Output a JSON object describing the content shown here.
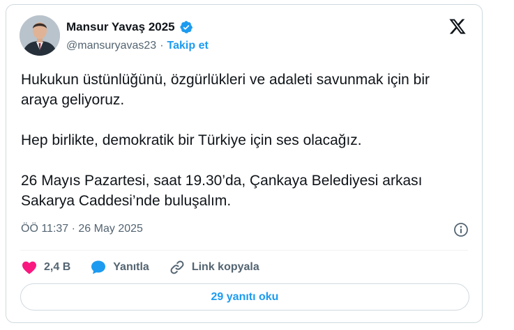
{
  "author": {
    "display_name": "Mansur Yavaş 2025",
    "handle": "@mansuryavas23",
    "separator": "·",
    "follow_label": "Takip et",
    "verified": true
  },
  "tweet": {
    "paragraphs": [
      "Hukukun üstünlüğünü, özgürlükleri ve adaleti savunmak için bir araya geliyoruz.",
      "Hep birlikte, demokratik bir Türkiye için ses olacağız.",
      "26 Mayıs Pazartesi, saat 19.30’da, Çankaya Belediyesi arkası Sakarya Caddesi’nde buluşalım."
    ],
    "timestamp": "ÖÖ 11:37 · 26 May 2025"
  },
  "actions": {
    "like_count": "2,4 B",
    "reply_label": "Yanıtla",
    "copy_link_label": "Link kopyala"
  },
  "read_replies_label": "29 yanıtı oku",
  "icons": {
    "platform": "x-logo-icon",
    "verified": "verified-badge-icon",
    "info": "info-icon",
    "like": "heart-icon",
    "reply": "speech-bubble-icon",
    "link": "link-icon"
  },
  "colors": {
    "accent": "#1d9bf0",
    "like": "#f91880",
    "text_primary": "#0f1419",
    "text_secondary": "#536471",
    "border": "#cfd9de"
  }
}
